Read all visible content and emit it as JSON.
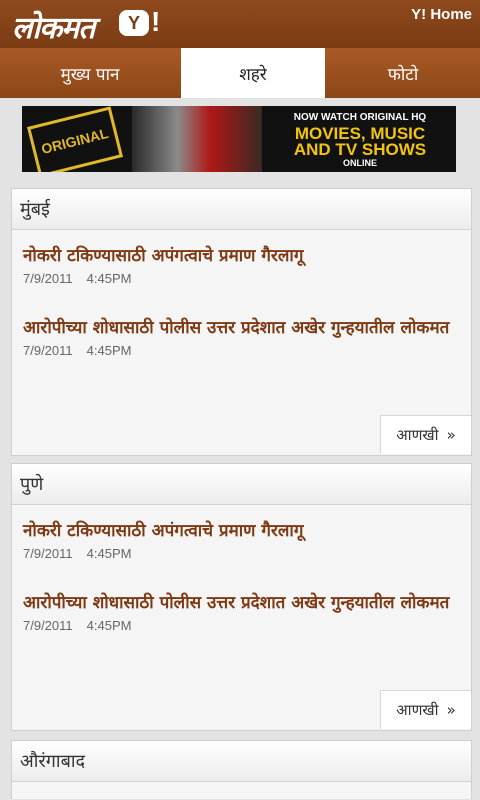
{
  "header": {
    "logo_text": "लोकमत",
    "yahoo_mark": "Y",
    "yahoo_excl": "!",
    "home_link": "Y! Home"
  },
  "tabs": [
    {
      "label": "मुख्य पान",
      "active": false
    },
    {
      "label": "शहरे",
      "active": true
    },
    {
      "label": "फोटो",
      "active": false
    }
  ],
  "banner": {
    "badge_text": "ORIGINAL",
    "line1": "NOW WATCH ORIGINAL HQ",
    "line2": "MOVIES, MUSIC",
    "line3": "AND TV SHOWS",
    "line4": "ONLINE"
  },
  "sections": [
    {
      "name": "मुंबई",
      "more_label": "आणखी",
      "more_arrow": "»",
      "items": [
        {
          "title": "नोकरी टकिण्यासाठी अपंगत्वाचे प्रमाण गैरलागू",
          "date": "7/9/2011",
          "time": "4:45PM"
        },
        {
          "title": "आरोपीच्या शोधासाठी पोलीस उत्तर प्रदेशात अखेर गुन्हयातील लोकमत",
          "date": "7/9/2011",
          "time": "4:45PM"
        }
      ]
    },
    {
      "name": "पुणे",
      "more_label": "आणखी",
      "more_arrow": "»",
      "items": [
        {
          "title": "नोकरी टकिण्यासाठी अपंगत्वाचे प्रमाण गैरलागू",
          "date": "7/9/2011",
          "time": "4:45PM"
        },
        {
          "title": "आरोपीच्या शोधासाठी पोलीस उत्तर प्रदेशात अखेर गुन्हयातील लोकमत",
          "date": "7/9/2011",
          "time": "4:45PM"
        }
      ]
    },
    {
      "name": "औरंगाबाद"
    }
  ]
}
